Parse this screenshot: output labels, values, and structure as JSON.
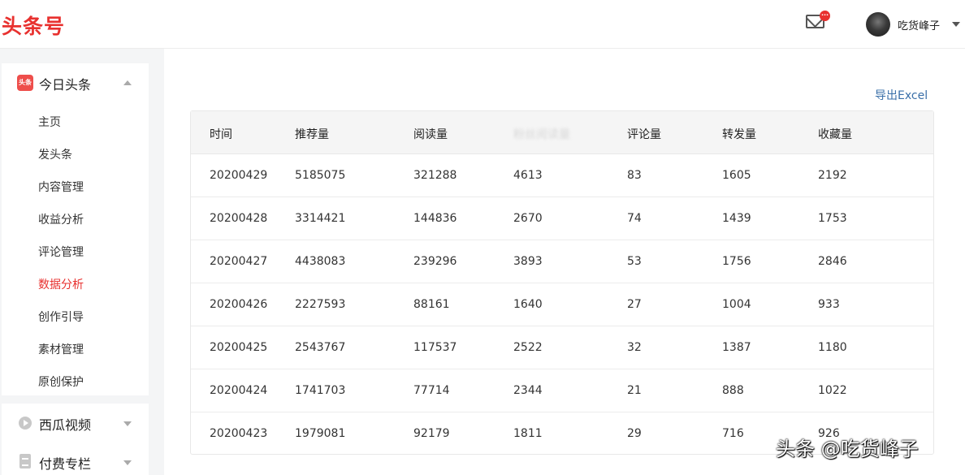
{
  "header": {
    "logo": "头条号",
    "mail_badge": "···",
    "username": "吃货峰子"
  },
  "sidebar": {
    "section_title": "今日头条",
    "section_icon_text": "头条",
    "items": [
      {
        "label": "主页",
        "active": false
      },
      {
        "label": "发头条",
        "active": false
      },
      {
        "label": "内容管理",
        "active": false
      },
      {
        "label": "收益分析",
        "active": false
      },
      {
        "label": "评论管理",
        "active": false
      },
      {
        "label": "数据分析",
        "active": true
      },
      {
        "label": "创作引导",
        "active": false
      },
      {
        "label": "素材管理",
        "active": false
      },
      {
        "label": "原创保护",
        "active": false
      }
    ],
    "other_sections": [
      {
        "label": "西瓜视频",
        "icon": "play-icon"
      },
      {
        "label": "付费专栏",
        "icon": "doc-icon"
      }
    ]
  },
  "main": {
    "export_label": "导出Excel",
    "columns": [
      "时间",
      "推荐量",
      "阅读量",
      "粉丝阅读量",
      "评论量",
      "转发量",
      "收藏量"
    ],
    "rows": [
      [
        "20200429",
        "5185075",
        "321288",
        "4613",
        "83",
        "1605",
        "2192"
      ],
      [
        "20200428",
        "3314421",
        "144836",
        "2670",
        "74",
        "1439",
        "1753"
      ],
      [
        "20200427",
        "4438083",
        "239296",
        "3893",
        "53",
        "1756",
        "2846"
      ],
      [
        "20200426",
        "2227593",
        "88161",
        "1640",
        "27",
        "1004",
        "933"
      ],
      [
        "20200425",
        "2543767",
        "117537",
        "2522",
        "32",
        "1387",
        "1180"
      ],
      [
        "20200424",
        "1741703",
        "77714",
        "2344",
        "21",
        "888",
        "1022"
      ],
      [
        "20200423",
        "1979081",
        "92179",
        "1811",
        "29",
        "716",
        "926"
      ]
    ]
  },
  "watermark": "头条 @吃货峰子",
  "colors": {
    "brand_red": "#e8312f",
    "link_blue": "#3a6fa8"
  }
}
